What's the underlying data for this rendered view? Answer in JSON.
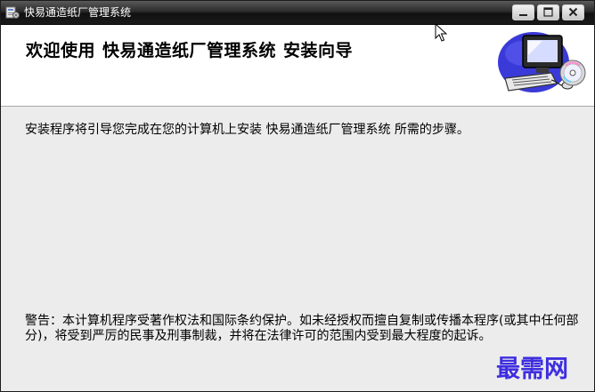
{
  "window": {
    "title": "快易通造纸厂管理系统",
    "icon": "installer-app-icon",
    "controls": [
      "minimize-icon",
      "maximize-icon",
      "close-icon"
    ]
  },
  "header": {
    "welcome": "欢迎使用",
    "product": "快易通造纸厂管理系统",
    "wizard": "安装向导",
    "art": "computer-cd-icon"
  },
  "body": {
    "intro": "安装程序将引导您完成在您的计算机上安装 快易通造纸厂管理系统 所需的步骤。",
    "warning": "警告：本计算机程序受著作权法和国际条约保护。如未经授权而擅自复制或传播本程序(或其中任何部分)，将受到严厉的民事及刑事制裁，并将在法律许可的范围内受到最大程度的起诉。"
  },
  "watermark": "最需网",
  "colors": {
    "titlebar": "#1a1a1a",
    "window_bg": "#ececec",
    "header_bg": "#ffffff",
    "watermark": "#3e2ee0"
  }
}
